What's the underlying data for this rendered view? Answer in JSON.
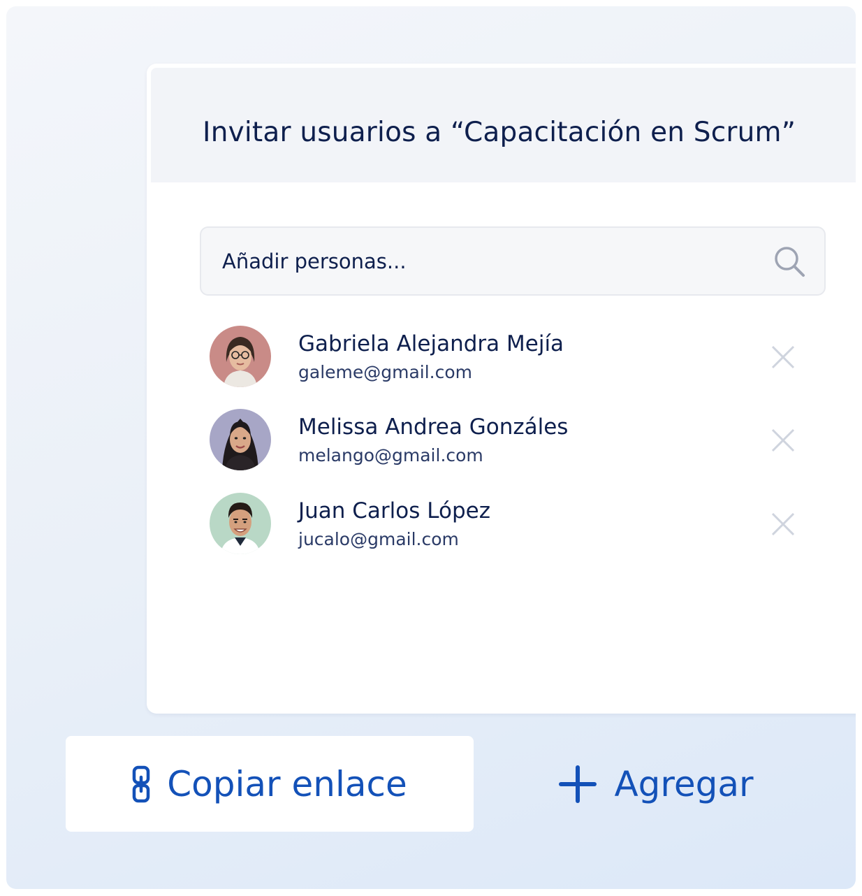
{
  "dialog": {
    "title": "Invitar usuarios a “Capacitación en Scrum”"
  },
  "search": {
    "placeholder": "Añadir personas...",
    "icon": "search-icon"
  },
  "users": [
    {
      "name": "Gabriela Alejandra Mejía",
      "email": "galeme@gmail.com",
      "avatar_bg": "#c98b87"
    },
    {
      "name": "Melissa Andrea Gonzáles",
      "email": "melango@gmail.com",
      "avatar_bg": "#a7a6c6"
    },
    {
      "name": "Juan Carlos López",
      "email": "jucalo@gmail.com",
      "avatar_bg": "#b9d8c6"
    }
  ],
  "actions": {
    "copy_link": {
      "label": "Copiar enlace",
      "icon": "link-icon"
    },
    "add": {
      "label": "Agregar",
      "icon": "plus-icon"
    }
  },
  "colors": {
    "accent": "#1351b8",
    "text_dark": "#0e1f4d",
    "remove_icon": "#cfd4de"
  }
}
